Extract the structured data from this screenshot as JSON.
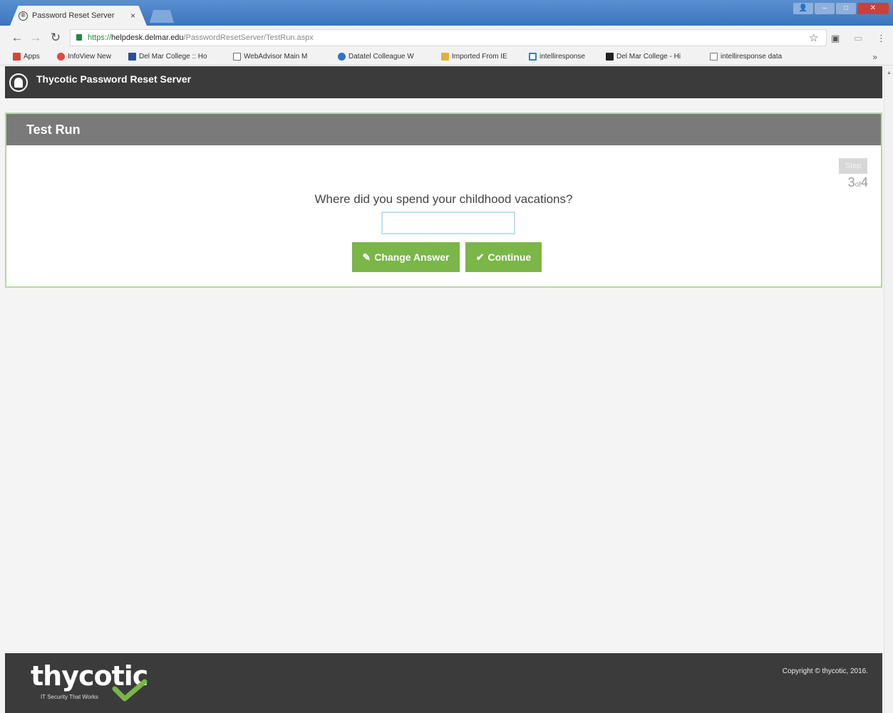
{
  "browser": {
    "tab_title": "Password Reset Server",
    "tab_close": "×",
    "url_scheme": "https://",
    "url_host": "helpdesk.delmar.edu",
    "url_path": "/PasswordResetServer/TestRun.aspx",
    "bookmarks": [
      {
        "label": "Apps",
        "color": "#d0473a"
      },
      {
        "label": "InfoView New",
        "color": "#e04a3a"
      },
      {
        "label": "Del Mar College :: Ho",
        "color": "#2a4f9a"
      },
      {
        "label": "WebAdvisor Main M",
        "color": "#6b6b6b"
      },
      {
        "label": "Datatel Colleague W",
        "color": "#2d74c9"
      },
      {
        "label": "Imported From IE",
        "color": "#e0b23a"
      },
      {
        "label": "intelliresponse",
        "color": "#2f7dd0"
      },
      {
        "label": "Del Mar College - Hi",
        "color": "#222222"
      },
      {
        "label": "intelliresponse data",
        "color": "#ffffff"
      }
    ],
    "more_bookmarks": "»"
  },
  "header": {
    "title": "Thycotic Password Reset Server"
  },
  "panel": {
    "title": "Test Run",
    "step_label": "Step",
    "step_current": "3",
    "step_of": "of",
    "step_total": "4",
    "question": "Where did you spend your childhood vacations?",
    "answer_value": "",
    "change_answer_label": "Change Answer",
    "continue_label": "Continue"
  },
  "footer": {
    "brand": "thycotic",
    "tagline": "IT Security That Works",
    "copyright": "Copyright © thycotic, 2016."
  },
  "colors": {
    "accent_green": "#7ab648",
    "header_bg": "#3b3b3b",
    "panel_header_bg": "#7a7a7a"
  }
}
